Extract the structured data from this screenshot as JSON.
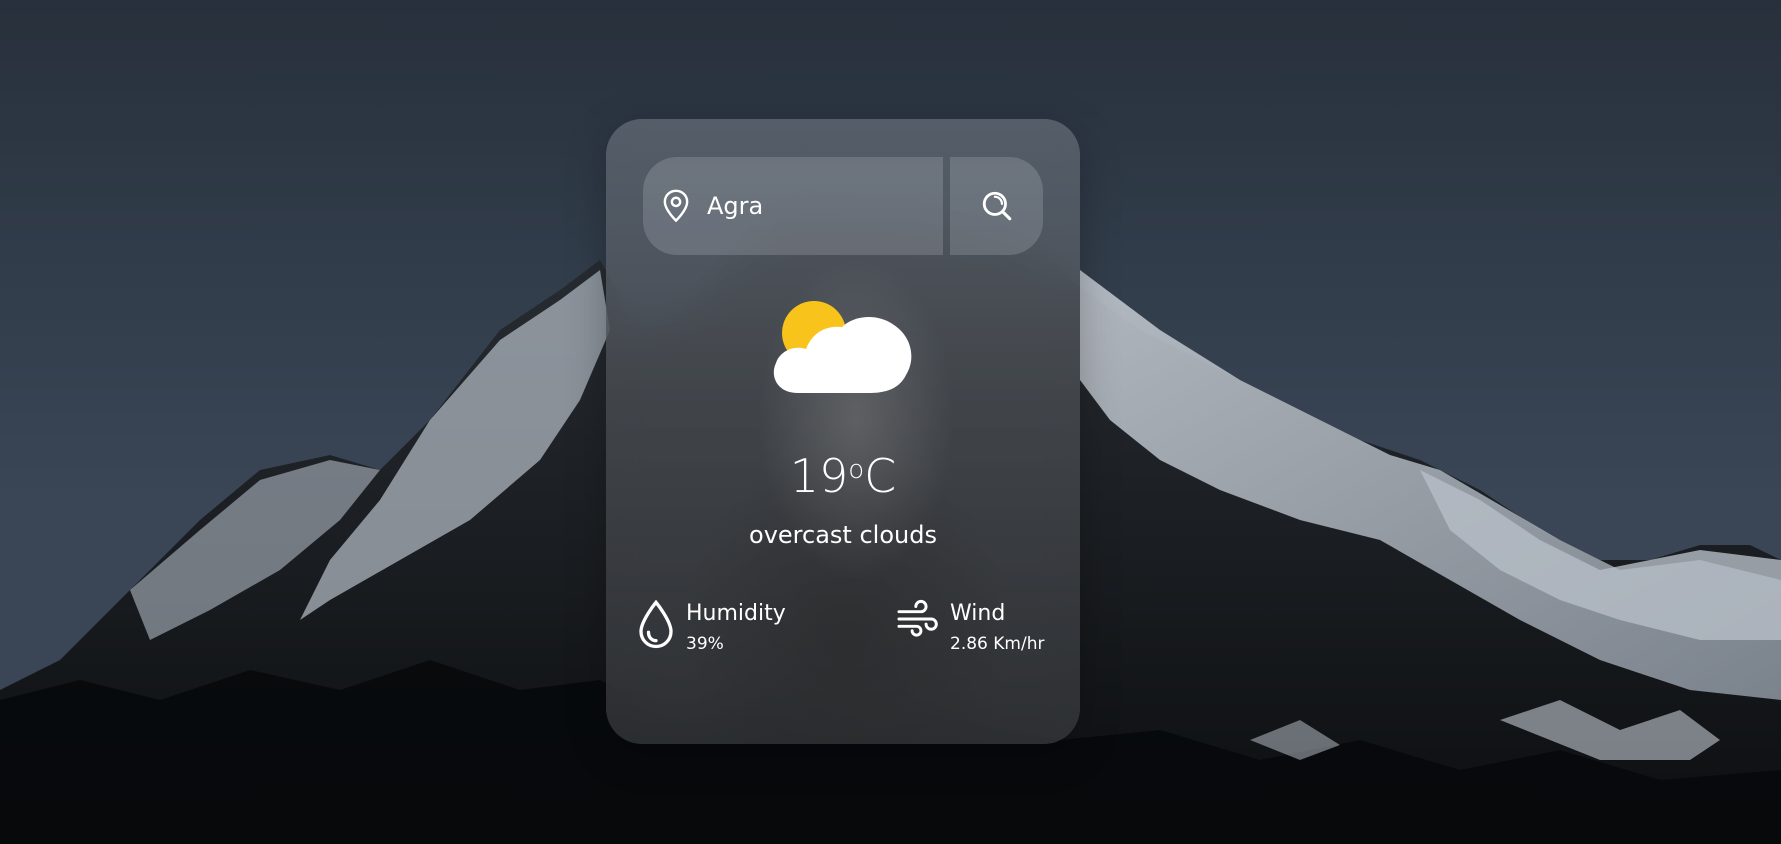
{
  "search": {
    "value": "Agra",
    "location_icon": "map-pin-icon",
    "search_icon": "search-icon"
  },
  "weather": {
    "icon": "partly-cloudy-icon",
    "temperature": "19",
    "unit_degree": "o",
    "unit": "C",
    "description": "overcast clouds"
  },
  "details": {
    "humidity": {
      "icon": "water-drop-icon",
      "label": "Humidity",
      "value": "39%"
    },
    "wind": {
      "icon": "wind-icon",
      "label": "Wind",
      "value": "2.86 Km/hr"
    }
  },
  "colors": {
    "sun": "#f8c31b",
    "cloud": "#ffffff",
    "text": "#ffffff"
  }
}
